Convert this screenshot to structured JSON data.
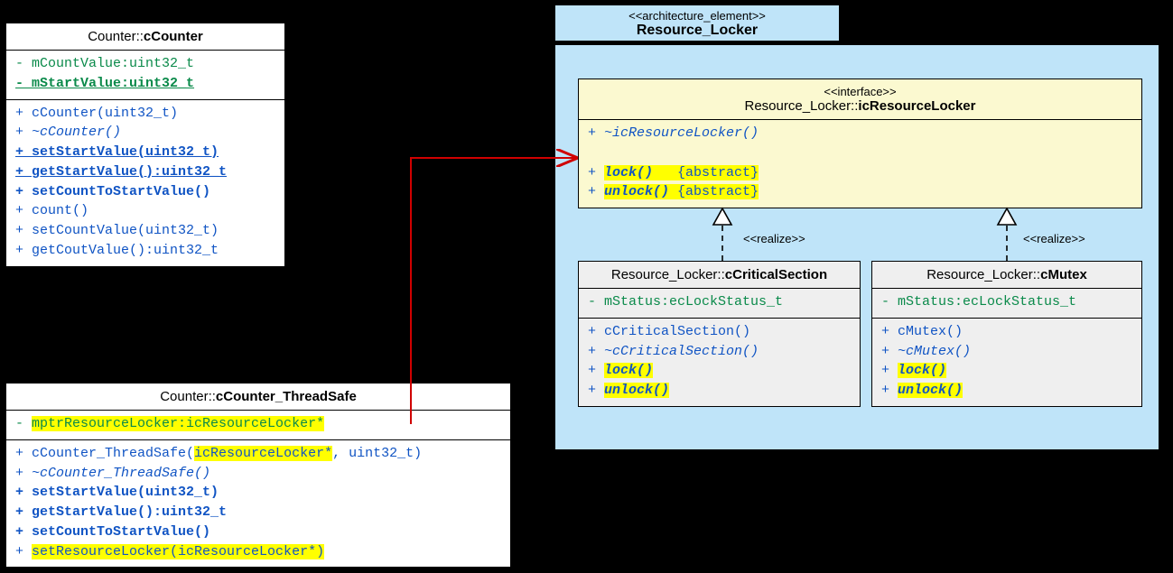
{
  "counter": {
    "title_ns": "Counter::",
    "title_cn": "cCounter",
    "attrs": {
      "a1": "- mCountValue:uint32_t",
      "a2": "- mStartValue:uint32_t"
    },
    "ops": {
      "o1": "+ cCounter(uint32_t)",
      "o2": "+ ~cCounter()",
      "o3": "+ setStartValue(uint32_t)",
      "o4": "+ getStartValue():uint32_t",
      "o5": "+ setCountToStartValue()",
      "o6": "+ count()",
      "o7": "+ setCountValue(uint32_t)",
      "o8": "+ getCoutValue():uint32_t"
    }
  },
  "threadsafe": {
    "title_ns": "Counter::",
    "title_cn": "cCounter_ThreadSafe",
    "attrs": {
      "a1_pre": "- ",
      "a1_hl": "mptrResourceLocker:icResourceLocker*"
    },
    "ops": {
      "o1_pre": "+ cCounter_ThreadSafe(",
      "o1_hl": "icResourceLocker*",
      "o1_post": ", uint32_t)",
      "o2": "+ ~cCounter_ThreadSafe()",
      "o3": "+ setStartValue(uint32_t)",
      "o4": "+ getStartValue():uint32_t",
      "o5": "+ setCountToStartValue()",
      "o6_pre": "+ ",
      "o6_hl": "setResourceLocker(icResourceLocker*)"
    }
  },
  "pkg": {
    "stereo": "<<architecture_element>>",
    "name": "Resource_Locker"
  },
  "iface": {
    "stereo": "<<interface>>",
    "title_ns": "Resource_Locker::",
    "title_cn": "icResourceLocker",
    "ops": {
      "o1": "+ ~icResourceLocker()",
      "blank": " ",
      "o2_pre": "+ ",
      "o2_hl": "lock()",
      "o2_post": "   {abstract}",
      "o3_pre": "+ ",
      "o3_hl": "unlock()",
      "o3_post": " {abstract}"
    }
  },
  "cs": {
    "title_ns": "Resource_Locker::",
    "title_cn": "cCriticalSection",
    "attrs": {
      "a1": "- mStatus:ecLockStatus_t"
    },
    "ops": {
      "o1": "+ cCriticalSection()",
      "o2": "+ ~cCriticalSection()",
      "o3_pre": "+ ",
      "o3_hl": "lock()",
      "o4_pre": "+ ",
      "o4_hl": "unlock()"
    }
  },
  "mutex": {
    "title_ns": "Resource_Locker::",
    "title_cn": "cMutex",
    "attrs": {
      "a1": "- mStatus:ecLockStatus_t"
    },
    "ops": {
      "o1": "+ cMutex()",
      "o2": "+ ~cMutex()",
      "o3_pre": "+ ",
      "o3_hl": "lock()",
      "o4_pre": "+ ",
      "o4_hl": "unlock()"
    }
  },
  "labels": {
    "realize1": "<<realize>>",
    "realize2": "<<realize>>"
  }
}
